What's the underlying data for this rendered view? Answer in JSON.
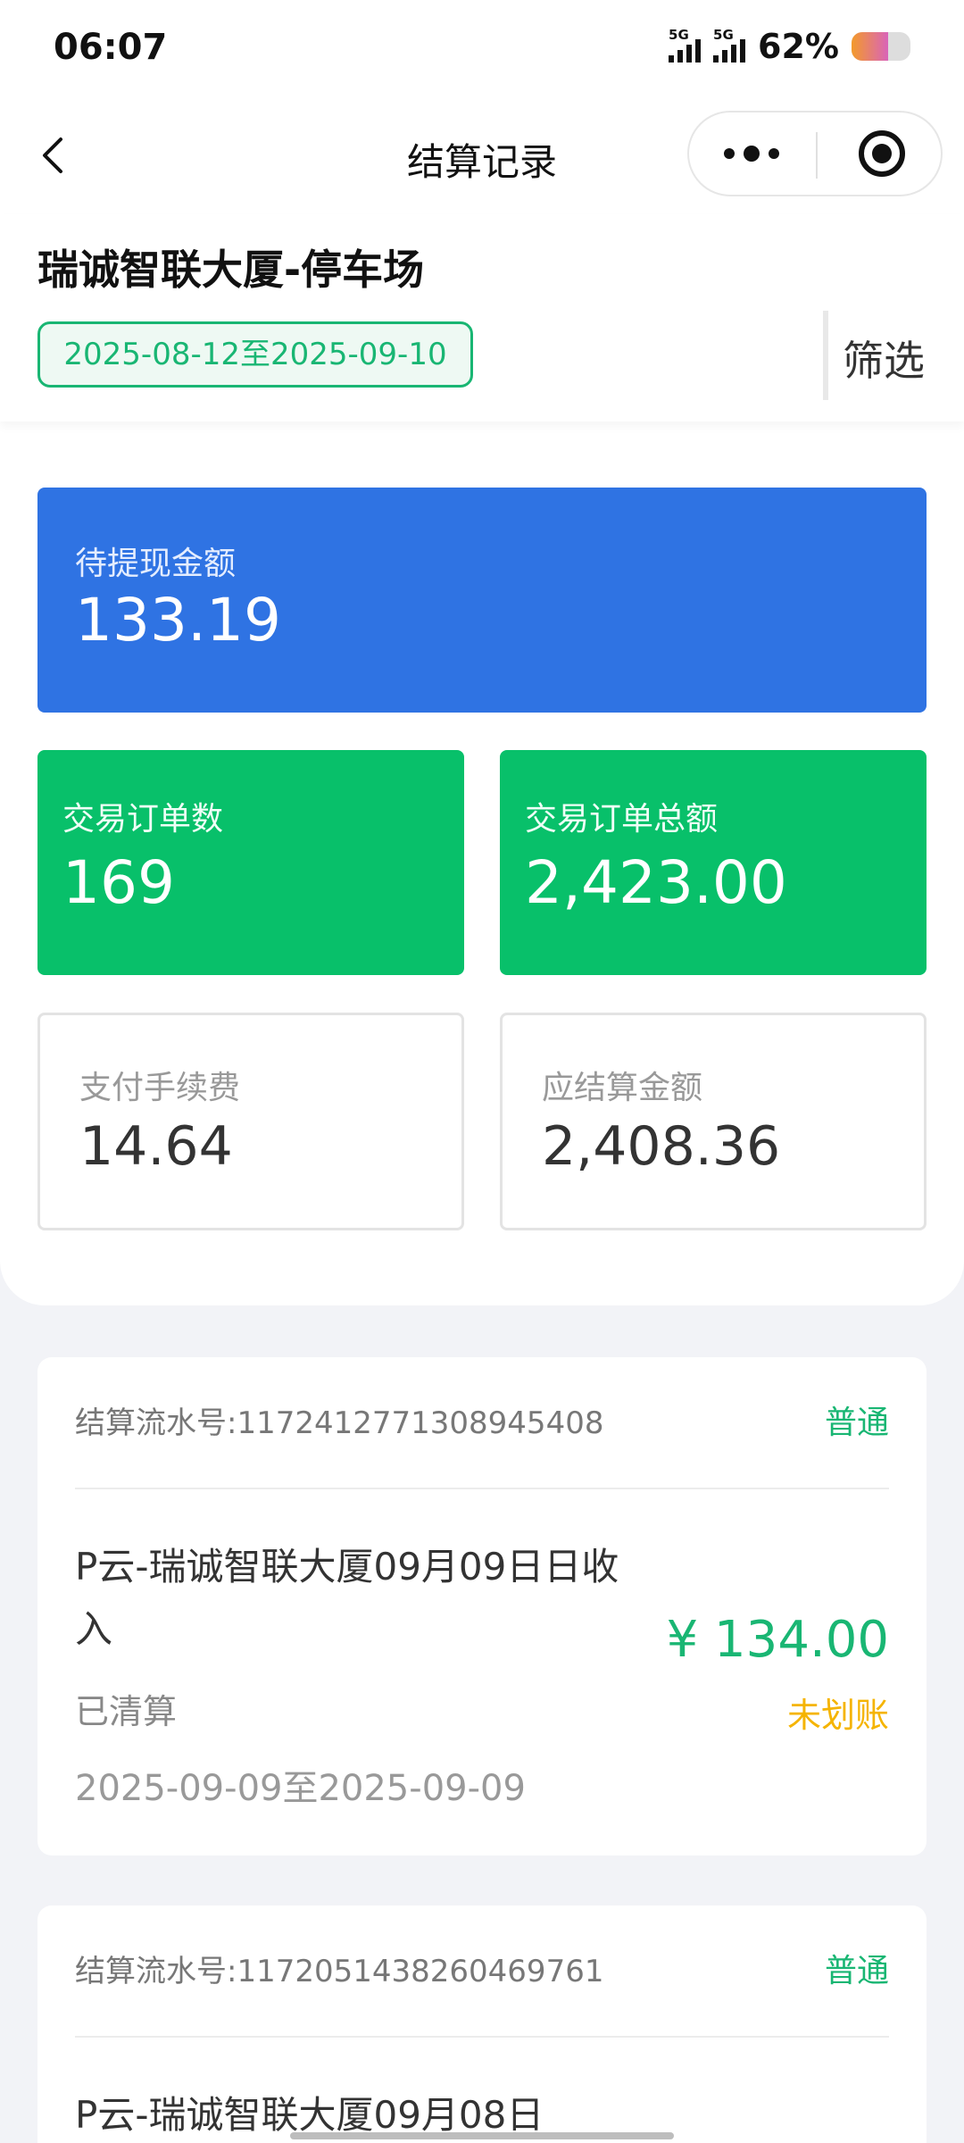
{
  "status_bar": {
    "time": "06:07",
    "signal_label_1": "5G",
    "signal_label_2": "5G",
    "battery_percent": "62%",
    "battery_level": 0.62
  },
  "nav": {
    "title": "结算记录",
    "icons": {
      "back": "chevron-left-icon",
      "more": "more-dots-icon",
      "close": "miniprogram-close-icon"
    }
  },
  "header": {
    "lot_name": "瑞诚智联大厦-停车场",
    "date_range": "2025-08-12至2025-09-10",
    "filter_label": "筛选"
  },
  "summary": {
    "pending_withdraw": {
      "label": "待提现金额",
      "value": "133.19"
    },
    "order_count": {
      "label": "交易订单数",
      "value": "169"
    },
    "order_total": {
      "label": "交易订单总额",
      "value": "2,423.00"
    },
    "fee": {
      "label": "支付手续费",
      "value": "14.64"
    },
    "settle_amount": {
      "label": "应结算金额",
      "value": "2,408.36"
    },
    "colors": {
      "blue": "#2f73e3",
      "green": "#08c06a"
    }
  },
  "records": [
    {
      "serial": "结算流水号:1172412771308945408",
      "type": "普通",
      "title": "P云-瑞诚智联大厦09月09日日收入",
      "status": "已清算",
      "period": "2025-09-09至2025-09-09",
      "amount": "¥ 134.00",
      "transfer_status": "未划账"
    },
    {
      "serial": "结算流水号:1172051438260469761",
      "type": "普通",
      "title": "P云-瑞诚智联大厦09月08日"
    }
  ]
}
